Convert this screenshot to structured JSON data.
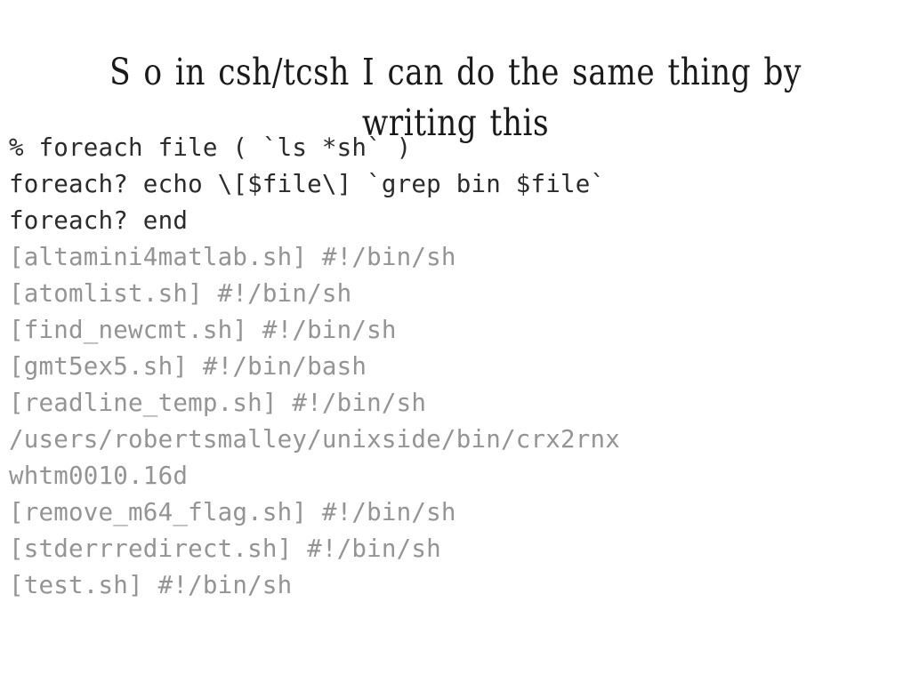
{
  "slide": {
    "title": "S o in csh/tcsh I can do the same thing by writing this",
    "background_color": "#ffffff",
    "command_color": "#2b2b2b",
    "output_color": "#949494",
    "terminal": {
      "lines": [
        {
          "kind": "command",
          "text": "% foreach file ( `ls *sh` )"
        },
        {
          "kind": "command",
          "text": "foreach? echo \\[$file\\] `grep bin $file`"
        },
        {
          "kind": "command",
          "text": "foreach? end"
        },
        {
          "kind": "output",
          "text": "[altamini4matlab.sh] #!/bin/sh"
        },
        {
          "kind": "output",
          "text": "[atomlist.sh] #!/bin/sh"
        },
        {
          "kind": "output",
          "text": "[find_newcmt.sh] #!/bin/sh"
        },
        {
          "kind": "output",
          "text": "[gmt5ex5.sh] #!/bin/bash"
        },
        {
          "kind": "output",
          "text": "[readline_temp.sh] #!/bin/sh"
        },
        {
          "kind": "output",
          "text": "/users/robertsmalley/unixside/bin/crx2rnx"
        },
        {
          "kind": "output",
          "text": "whtm0010.16d"
        },
        {
          "kind": "output",
          "text": "[remove_m64_flag.sh] #!/bin/sh"
        },
        {
          "kind": "output",
          "text": "[stderrredirect.sh] #!/bin/sh"
        },
        {
          "kind": "output",
          "text": "[test.sh] #!/bin/sh"
        }
      ]
    }
  }
}
